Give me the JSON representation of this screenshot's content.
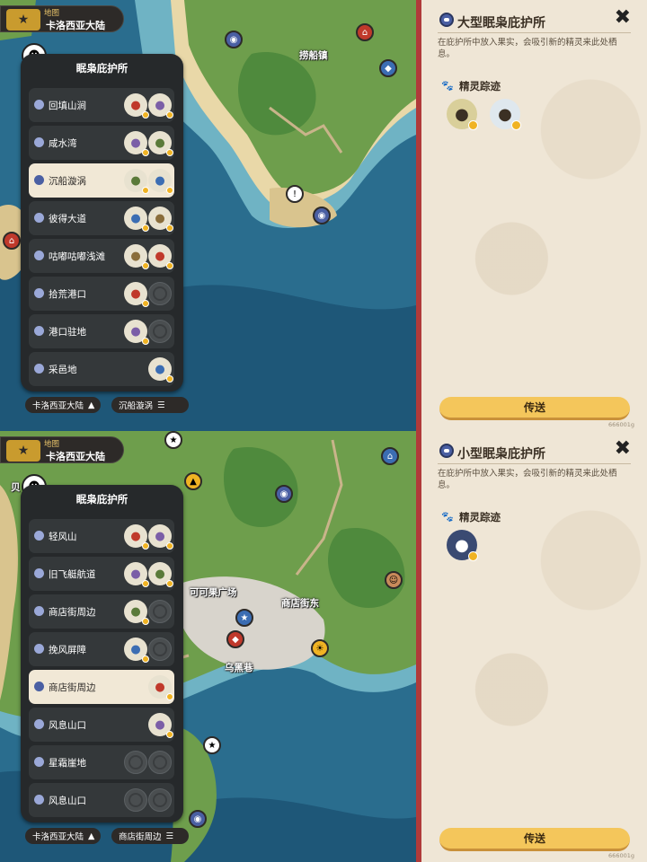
{
  "top": {
    "map": {
      "label": "地图",
      "region": "卡洛西亚大陆",
      "logo_glyph": "★",
      "towns": [
        "捞船镇"
      ]
    },
    "panel": {
      "title": "眠枭庇护所",
      "rows": [
        {
          "name": "回填山涧",
          "slots": [
            "filled",
            "filled"
          ],
          "selected": false
        },
        {
          "name": "咸水湾",
          "slots": [
            "filled",
            "filled"
          ],
          "selected": false
        },
        {
          "name": "沉船漩涡",
          "slots": [
            "filled",
            "filled"
          ],
          "selected": true
        },
        {
          "name": "彼得大道",
          "slots": [
            "filled",
            "filled"
          ],
          "selected": false
        },
        {
          "name": "咕嘟咕嘟浅滩",
          "slots": [
            "filled",
            "filled"
          ],
          "selected": false
        },
        {
          "name": "拾荒港口",
          "slots": [
            "filled",
            "empty"
          ],
          "selected": false
        },
        {
          "name": "港口驻地",
          "slots": [
            "filled",
            "empty"
          ],
          "selected": false
        },
        {
          "name": "采邑地",
          "slots": [
            "none",
            "filled"
          ],
          "selected": false
        }
      ]
    },
    "bottom_left": "卡洛西亚大陆",
    "bottom_left_icon": "▲",
    "bottom_right": "沉船漩涡",
    "bottom_right_icon": "☰",
    "card": {
      "title": "大型眠枭庇护所",
      "close": "✖",
      "desc": "在庇护所中放入果实，会吸引新的精灵来此处栖息。",
      "section": "精灵踪迹",
      "paw": "🐾",
      "track_count": 2,
      "button": "传送",
      "code": "666001g"
    }
  },
  "bottom": {
    "map": {
      "label": "地图",
      "region": "卡洛西亚大陆",
      "logo_glyph": "★",
      "towns": [
        "可可果广场",
        "商店街东",
        "乌黑巷"
      ],
      "edge_text": "贝"
    },
    "panel": {
      "title": "眠枭庇护所",
      "rows": [
        {
          "name": "轻风山",
          "slots": [
            "filled",
            "filled"
          ],
          "selected": false
        },
        {
          "name": "旧飞艇航道",
          "slots": [
            "filled",
            "filled"
          ],
          "selected": false
        },
        {
          "name": "商店街周边",
          "slots": [
            "filled",
            "empty"
          ],
          "selected": false
        },
        {
          "name": "挽风屏障",
          "slots": [
            "filled",
            "empty"
          ],
          "selected": false
        },
        {
          "name": "商店街周边",
          "slots": [
            "none",
            "filled"
          ],
          "selected": true
        },
        {
          "name": "风息山口",
          "slots": [
            "none",
            "filled"
          ],
          "selected": false
        },
        {
          "name": "星霜崖地",
          "slots": [
            "empty",
            "empty"
          ],
          "selected": false
        },
        {
          "name": "风息山口",
          "slots": [
            "empty",
            "empty"
          ],
          "selected": false
        }
      ]
    },
    "bottom_left": "卡洛西亚大陆",
    "bottom_left_icon": "▲",
    "bottom_right": "商店街周边",
    "bottom_right_icon": "☰",
    "card": {
      "title": "小型眠枭庇护所",
      "close": "✖",
      "desc": "在庇护所中放入果实，会吸引新的精灵来此处栖息。",
      "section": "精灵踪迹",
      "paw": "🐾",
      "track_count": 1,
      "button": "传送",
      "code": "666001g"
    }
  }
}
